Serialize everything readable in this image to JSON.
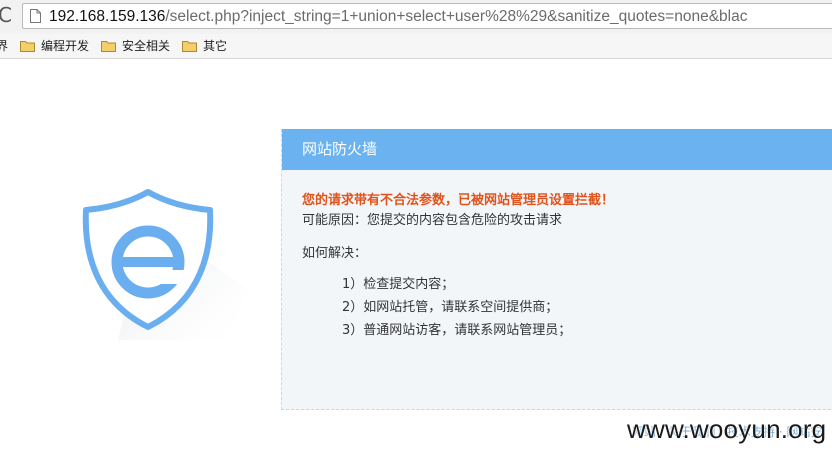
{
  "browser": {
    "reload_icon": "reload-icon",
    "url_host": "192.168.159.136",
    "url_path": "/select.php?inject_string=1+union+select+user%28%29&sanitize_quotes=none&blac",
    "bookmarks_cut_label": "界",
    "bookmarks": [
      {
        "label": "编程开发",
        "icon": "folder-icon"
      },
      {
        "label": "安全相关",
        "icon": "folder-icon"
      },
      {
        "label": "其它",
        "icon": "folder-icon"
      }
    ]
  },
  "waf": {
    "title": "网站防火墙",
    "warning": "您的请求带有不合法参数，已被网站管理员设置拦截！",
    "reason": "可能原因：您提交的内容包含危险的攻击请求",
    "solve_heading": "如何解决：",
    "steps": [
      "1）检查提交内容；",
      "2）如网站托管，请联系空间提供商；",
      "3）普通网站访客，请联系网站管理员；"
    ],
    "logo_letter": "e"
  },
  "footer": {
    "links_text": "网站 · 关于我们 · 技术支持 · 网站安",
    "watermark": "www.wooyun.org"
  },
  "colors": {
    "header_blue": "#6bb3f0",
    "warning_orange": "#e2531b",
    "shield_blue": "#6aaef0"
  }
}
